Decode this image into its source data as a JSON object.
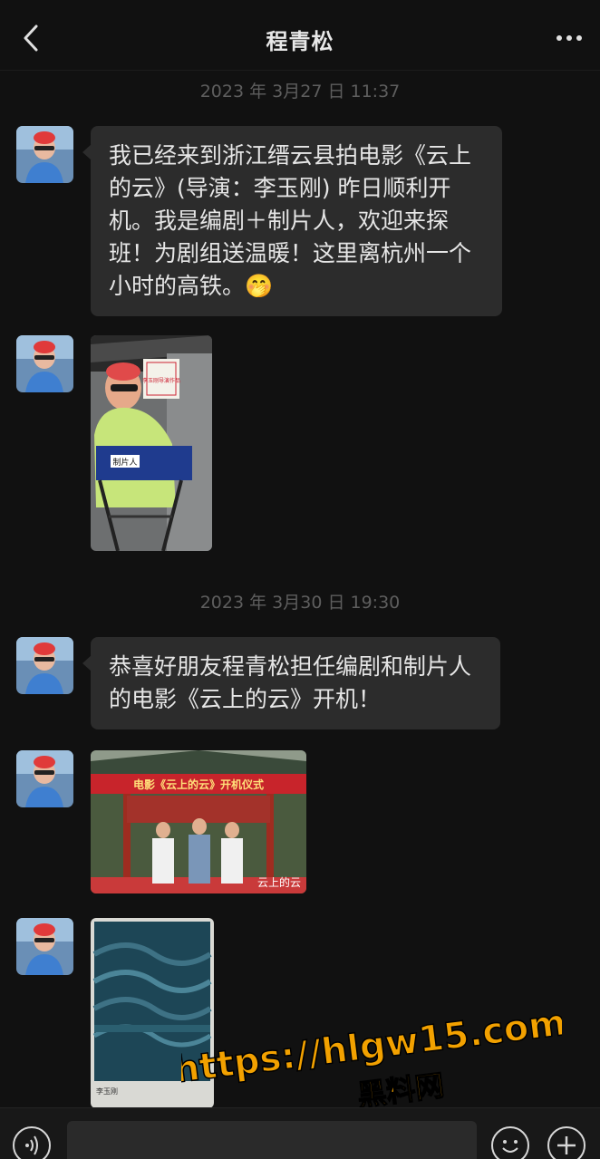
{
  "header": {
    "title": "程青松",
    "back_icon": "chevron-left-icon",
    "more_icon": "more-dots-icon"
  },
  "timestamps": [
    "2023 年 3月27 日 11:37",
    "2023 年 3月30 日 19:30"
  ],
  "messages": [
    {
      "type": "text",
      "lines": [
        "我已经来到浙江缙云县拍电影《云上",
        "的云》(导演：李玉刚) 昨日顺利开",
        "机。我是编剧＋制片人，欢迎来探",
        "班！为剧组送温暖！这里离杭州一个",
        "小时的高铁。🤭"
      ]
    },
    {
      "type": "image",
      "chair_text": "制片人",
      "sign_text": "李玉刚导演作品"
    },
    {
      "type": "text",
      "lines": [
        "恭喜好朋友程青松担任编剧和制片人",
        "的电影《云上的云》开机！"
      ]
    },
    {
      "type": "image",
      "banner_text": "电影《云上的云》开机仪式",
      "corner_text": "云上的云"
    },
    {
      "type": "image",
      "poster_caption": "李玉刚"
    }
  ],
  "watermark": {
    "line1": "https://hlgw15.com",
    "line2": "黑料网"
  },
  "bottom": {
    "voice_icon": "voice-icon",
    "emoji_icon": "emoji-icon",
    "plus_icon": "plus-icon"
  },
  "colors": {
    "background": "#111111",
    "bubble": "#2c2c2c",
    "watermark": "#f2a100"
  }
}
